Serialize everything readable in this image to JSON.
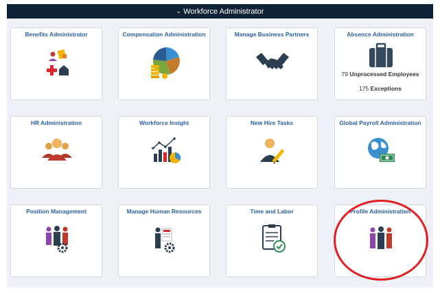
{
  "header": {
    "title": "Workforce Administrator",
    "chevron": "⌄"
  },
  "tiles": [
    {
      "title": "Benefits Administrator",
      "icon": "benefits-icon"
    },
    {
      "title": "Compensation Administration",
      "icon": "compensation-icon"
    },
    {
      "title": "Manage Business Partners",
      "icon": "handshake-icon"
    },
    {
      "title": "Absence Administration",
      "icon": "briefcase-icon",
      "metrics": [
        {
          "value": "79",
          "label": "Unprocessed Employees"
        },
        {
          "value": "175",
          "label": "Exceptions"
        }
      ]
    },
    {
      "title": "HR Administration",
      "icon": "people-group-icon"
    },
    {
      "title": "Workforce Insight",
      "icon": "analytics-chart-icon"
    },
    {
      "title": "New Hire Tasks",
      "icon": "person-pencil-icon"
    },
    {
      "title": "Global Payroll Administration",
      "icon": "globe-money-icon"
    },
    {
      "title": "Position Management",
      "icon": "people-gear-icon"
    },
    {
      "title": "Manage Human Resources",
      "icon": "person-document-gear-icon"
    },
    {
      "title": "Time and Labor",
      "icon": "clipboard-check-icon"
    },
    {
      "title": "Profile Administration",
      "icon": "people-trio-icon"
    }
  ],
  "colors": {
    "header_bg": "#0e2235",
    "tile_title": "#2a5fa6",
    "canvas_bg": "#eef1f5",
    "highlight": "#e01e24"
  }
}
